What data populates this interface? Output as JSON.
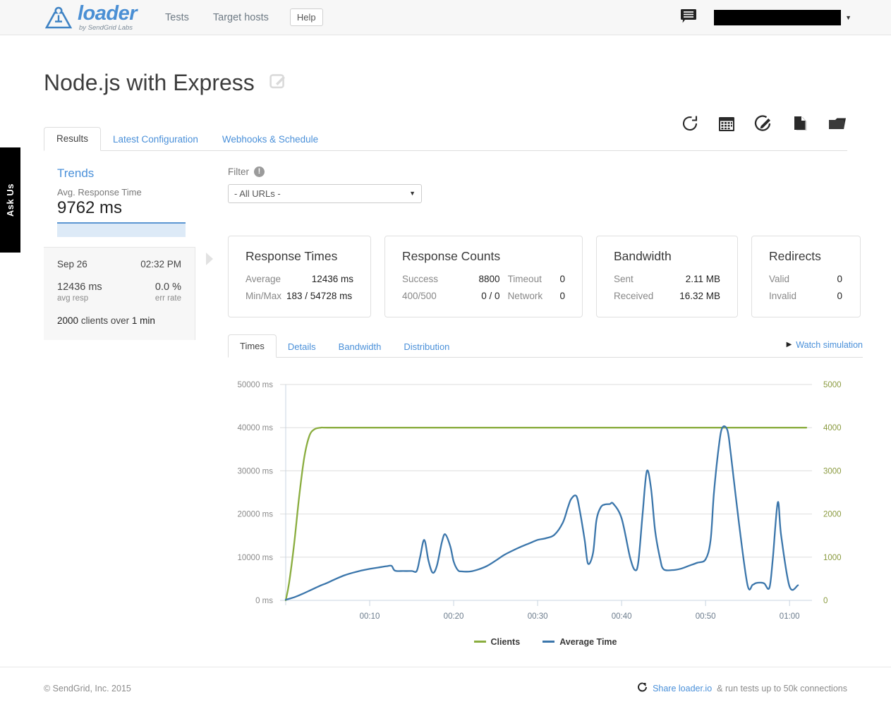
{
  "header": {
    "logo_word": "loader",
    "logo_sub": "by SendGrid Labs",
    "logo_icon": "loader-weight-logo",
    "nav": [
      {
        "label": "Tests",
        "name": "nav-tests"
      },
      {
        "label": "Target hosts",
        "name": "nav-target-hosts"
      }
    ],
    "help_label": "Help",
    "chat_icon": "chat-bubble-icon",
    "user_menu_label": "",
    "user_caret": "▼"
  },
  "ask_us": {
    "label": "Ask Us"
  },
  "page": {
    "title": "Node.js with Express",
    "title_edit_icon": "edit-pencil-icon"
  },
  "toolbar": {
    "icons": [
      {
        "name": "refresh-icon",
        "title": "Refresh"
      },
      {
        "name": "calendar-icon",
        "title": "Schedule"
      },
      {
        "name": "edit-icon",
        "title": "Edit"
      },
      {
        "name": "file-icon",
        "title": "Duplicate"
      },
      {
        "name": "folder-icon",
        "title": "Folder"
      }
    ]
  },
  "main_tabs": [
    {
      "label": "Results",
      "active": true
    },
    {
      "label": "Latest Configuration",
      "active": false
    },
    {
      "label": "Webhooks & Schedule",
      "active": false
    }
  ],
  "trends": {
    "title": "Trends",
    "metric_label": "Avg. Response Time",
    "metric_value": "9762 ms",
    "sparkline_color": "#5b96d2",
    "sparkline_fill": "#ddeaf7",
    "run": {
      "date": "Sep 26",
      "time": "02:32 PM",
      "avg_resp_value": "12436 ms",
      "avg_resp_label": "avg resp",
      "err_rate_value": "0.0 %",
      "err_rate_label": "err rate",
      "clients_count": "2000",
      "clients_word": "clients over",
      "duration": "1 min"
    },
    "expand_arrow": "chevron-right-icon"
  },
  "filter": {
    "label": "Filter",
    "info_icon": "info-icon",
    "selected": "- All URLs -",
    "options": [
      "- All URLs -"
    ]
  },
  "cards": [
    {
      "title": "Response Times",
      "rows": [
        {
          "key": "Average",
          "value": "12436 ms"
        },
        {
          "key": "Min/Max",
          "value": "183 / 54728 ms"
        }
      ]
    },
    {
      "title": "Response Counts",
      "rows": [
        {
          "key": "Success",
          "value": "8800",
          "key2": "Timeout",
          "value2": "0"
        },
        {
          "key": "400/500",
          "value": "0 / 0",
          "key2": "Network",
          "value2": "0"
        }
      ]
    },
    {
      "title": "Bandwidth",
      "rows": [
        {
          "key": "Sent",
          "value": "2.11 MB"
        },
        {
          "key": "Received",
          "value": "16.32 MB"
        }
      ]
    },
    {
      "title": "Redirects",
      "rows": [
        {
          "key": "Valid",
          "value": "0"
        },
        {
          "key": "Invalid",
          "value": "0"
        }
      ]
    }
  ],
  "chart_tabs": [
    {
      "label": "Times",
      "active": true
    },
    {
      "label": "Details",
      "active": false
    },
    {
      "label": "Bandwidth",
      "active": false
    },
    {
      "label": "Distribution",
      "active": false
    }
  ],
  "watch_simulation": {
    "label": "Watch simulation",
    "icon": "play-triangle-icon"
  },
  "chart_data": {
    "type": "line",
    "title": "",
    "xlabel": "",
    "ylabel": "",
    "grid": true,
    "legend_position": "bottom-center",
    "x_ticks": [
      "00:10",
      "00:20",
      "00:30",
      "00:40",
      "00:50",
      "01:00"
    ],
    "x_tick_seconds": [
      10,
      20,
      30,
      40,
      50,
      60
    ],
    "xlim": [
      0,
      62
    ],
    "left_axis": {
      "label": "",
      "tick_labels": [
        "0 ms",
        "10000 ms",
        "20000 ms",
        "30000 ms",
        "40000 ms",
        "50000 ms"
      ],
      "ticks": [
        0,
        10000,
        20000,
        30000,
        40000,
        50000
      ],
      "ylim": [
        0,
        50000
      ],
      "color": "#8a8a8a"
    },
    "right_axis": {
      "label": "",
      "tick_labels": [
        "0",
        "1000",
        "2000",
        "3000",
        "4000",
        "5000"
      ],
      "ticks": [
        0,
        1000,
        2000,
        3000,
        4000,
        5000
      ],
      "ylim": [
        0,
        5000
      ],
      "color": "#8a9a3f"
    },
    "series": [
      {
        "name": "Clients",
        "color": "#8aad3f",
        "axis": "right",
        "unit": "clients",
        "x": [
          0,
          0.4,
          1.0,
          1.6,
          2.2,
          2.8,
          3.4,
          4.2,
          5,
          10,
          20,
          30,
          40,
          50,
          60,
          62
        ],
        "values": [
          0,
          400,
          1300,
          2400,
          3300,
          3800,
          3960,
          4000,
          4000,
          4000,
          4000,
          4000,
          4000,
          4000,
          4000,
          4000
        ]
      },
      {
        "name": "Average Time",
        "color": "#3b76ab",
        "axis": "left",
        "unit": "ms",
        "x": [
          0,
          1,
          2,
          3,
          4,
          5,
          6,
          7,
          8,
          9,
          10,
          11,
          12,
          12.6,
          13,
          14,
          15,
          15.6,
          16,
          16.5,
          17,
          17.5,
          18,
          18.6,
          19,
          19.6,
          20,
          20.5,
          21,
          22,
          23,
          24,
          25,
          26,
          27,
          28,
          29,
          30,
          31,
          32,
          33,
          33.6,
          34,
          34.6,
          35,
          35.6,
          36,
          36.6,
          37,
          37.5,
          38,
          38.6,
          39,
          40,
          41,
          41.6,
          42,
          42.5,
          43,
          43.5,
          44,
          44.6,
          45,
          46,
          47,
          48,
          49,
          50,
          50.6,
          51,
          51.6,
          52,
          52.6,
          53,
          54,
          55,
          55.6,
          56,
          56.6,
          57,
          57.6,
          58,
          58.6,
          59,
          60,
          61
        ],
        "values": [
          150,
          700,
          1500,
          2400,
          3300,
          4100,
          5000,
          5800,
          6400,
          6900,
          7300,
          7600,
          7900,
          8000,
          6900,
          6800,
          6800,
          6800,
          10000,
          14000,
          9200,
          6400,
          8000,
          13500,
          15300,
          12500,
          9000,
          7000,
          6700,
          6700,
          7200,
          8000,
          9200,
          10500,
          11500,
          12400,
          13200,
          14000,
          14400,
          15200,
          18000,
          21500,
          23500,
          24200,
          21000,
          14000,
          8500,
          11000,
          18500,
          21500,
          22200,
          22300,
          22400,
          19000,
          10000,
          7000,
          9000,
          20000,
          29900,
          26000,
          16000,
          9500,
          7200,
          7000,
          7300,
          8000,
          8700,
          9500,
          14000,
          25000,
          36000,
          40000,
          39400,
          34000,
          17500,
          3500,
          3600,
          4000,
          4100,
          3900,
          2900,
          9500,
          22700,
          15000,
          3200,
          3500,
          4600
        ]
      }
    ]
  },
  "legend": [
    {
      "label": "Clients",
      "color": "#8aad3f"
    },
    {
      "label": "Average Time",
      "color": "#3b76ab"
    }
  ],
  "footer": {
    "copyright": "© SendGrid, Inc. 2015",
    "share_icon": "share-icon",
    "share_link": "Share loader.io",
    "share_rest": "& run tests up to 50k connections"
  }
}
